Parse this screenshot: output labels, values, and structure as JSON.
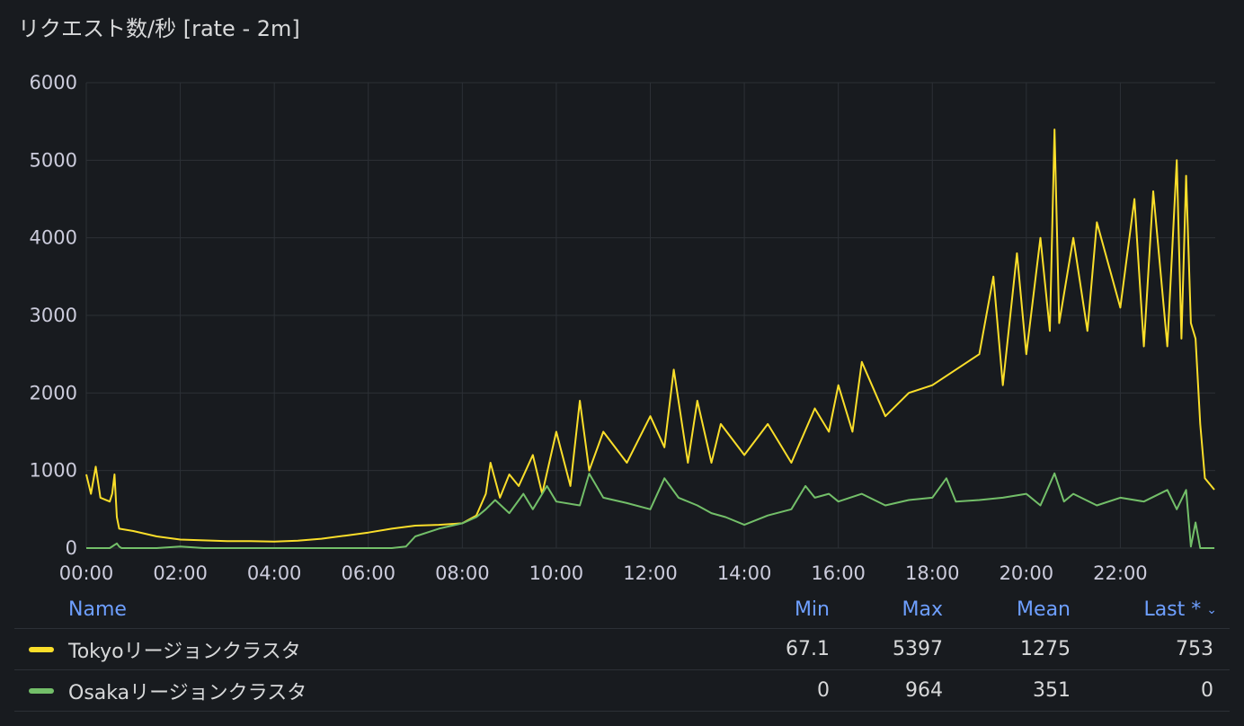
{
  "panel": {
    "title": "リクエスト数/秒 [rate - 2m]"
  },
  "colors": {
    "background": "#181b1f",
    "grid": "#2c3036",
    "axis_text": "#ccccdc",
    "tokyo": "#fade2a",
    "osaka": "#73bf69",
    "legend_header": "#6e9fff"
  },
  "chart_data": {
    "type": "line",
    "title": "リクエスト数/秒 [rate - 2m]",
    "xlabel": "",
    "ylabel": "",
    "x_unit": "hours",
    "xlim": [
      0,
      24
    ],
    "ylim": [
      0,
      6000
    ],
    "grid": true,
    "legend_position": "bottom",
    "y_ticks": [
      "0",
      "1000",
      "2000",
      "3000",
      "4000",
      "5000",
      "6000"
    ],
    "x_ticks": [
      "00:00",
      "02:00",
      "04:00",
      "06:00",
      "08:00",
      "10:00",
      "12:00",
      "14:00",
      "16:00",
      "18:00",
      "20:00",
      "22:00"
    ],
    "series": [
      {
        "name": "Tokyoリージョンクラスタ",
        "color": "#fade2a",
        "x": [
          0.0,
          0.1,
          0.2,
          0.3,
          0.5,
          0.55,
          0.6,
          0.65,
          0.7,
          1.0,
          1.5,
          2.0,
          2.5,
          3.0,
          3.5,
          4.0,
          4.5,
          5.0,
          5.5,
          6.0,
          6.5,
          7.0,
          7.5,
          8.0,
          8.3,
          8.5,
          8.6,
          8.8,
          9.0,
          9.2,
          9.5,
          9.7,
          10.0,
          10.3,
          10.5,
          10.7,
          11.0,
          11.5,
          12.0,
          12.3,
          12.5,
          12.8,
          13.0,
          13.3,
          13.5,
          14.0,
          14.5,
          15.0,
          15.5,
          15.8,
          16.0,
          16.3,
          16.5,
          17.0,
          17.5,
          18.0,
          18.5,
          19.0,
          19.3,
          19.5,
          19.8,
          20.0,
          20.3,
          20.5,
          20.6,
          20.7,
          21.0,
          21.3,
          21.5,
          22.0,
          22.3,
          22.5,
          22.7,
          23.0,
          23.2,
          23.3,
          23.4,
          23.5,
          23.6,
          23.7,
          23.8,
          24.0
        ],
        "y": [
          950,
          700,
          1050,
          650,
          600,
          700,
          950,
          400,
          250,
          220,
          150,
          110,
          100,
          90,
          90,
          85,
          95,
          120,
          160,
          200,
          250,
          290,
          300,
          320,
          420,
          700,
          1100,
          650,
          950,
          800,
          1200,
          700,
          1500,
          800,
          1900,
          1000,
          1500,
          1100,
          1700,
          1300,
          2300,
          1100,
          1900,
          1100,
          1600,
          1200,
          1600,
          1100,
          1800,
          1500,
          2100,
          1500,
          2400,
          1700,
          2000,
          2100,
          2300,
          2500,
          3500,
          2100,
          3800,
          2500,
          4000,
          2800,
          5397,
          2900,
          4000,
          2800,
          4200,
          3100,
          4500,
          2600,
          4600,
          2600,
          5000,
          2700,
          4800,
          2900,
          2700,
          1600,
          900,
          753
        ]
      },
      {
        "name": "Osakaリージョンクラスタ",
        "color": "#73bf69",
        "x": [
          0.0,
          0.3,
          0.5,
          0.65,
          0.7,
          0.75,
          1.0,
          1.5,
          2.0,
          2.5,
          3.0,
          4.0,
          5.0,
          6.0,
          6.5,
          6.8,
          7.0,
          7.5,
          8.0,
          8.3,
          8.5,
          8.7,
          9.0,
          9.3,
          9.5,
          9.8,
          10.0,
          10.5,
          10.7,
          11.0,
          11.5,
          12.0,
          12.3,
          12.6,
          13.0,
          13.3,
          13.6,
          14.0,
          14.5,
          15.0,
          15.3,
          15.5,
          15.8,
          16.0,
          16.5,
          17.0,
          17.5,
          18.0,
          18.3,
          18.5,
          19.0,
          19.5,
          20.0,
          20.3,
          20.6,
          20.8,
          21.0,
          21.5,
          22.0,
          22.5,
          23.0,
          23.2,
          23.4,
          23.5,
          23.6,
          23.7,
          24.0
        ],
        "y": [
          0,
          0,
          0,
          60,
          20,
          0,
          0,
          0,
          20,
          0,
          0,
          0,
          0,
          0,
          0,
          20,
          150,
          250,
          320,
          400,
          500,
          620,
          450,
          700,
          500,
          800,
          600,
          550,
          960,
          650,
          580,
          500,
          900,
          650,
          550,
          450,
          400,
          300,
          420,
          500,
          800,
          650,
          700,
          600,
          700,
          550,
          620,
          650,
          900,
          600,
          620,
          650,
          700,
          550,
          964,
          600,
          700,
          550,
          650,
          600,
          750,
          500,
          750,
          20,
          330,
          0,
          0
        ]
      }
    ]
  },
  "legend": {
    "columns": {
      "name": "Name",
      "min": "Min",
      "max": "Max",
      "mean": "Mean",
      "last": "Last *"
    },
    "sort_icon": "chevron-down-icon",
    "rows": [
      {
        "name": "Tokyoリージョンクラスタ",
        "color": "#fade2a",
        "min": "67.1",
        "max": "5397",
        "mean": "1275",
        "last": "753"
      },
      {
        "name": "Osakaリージョンクラスタ",
        "color": "#73bf69",
        "min": "0",
        "max": "964",
        "mean": "351",
        "last": "0"
      }
    ]
  }
}
